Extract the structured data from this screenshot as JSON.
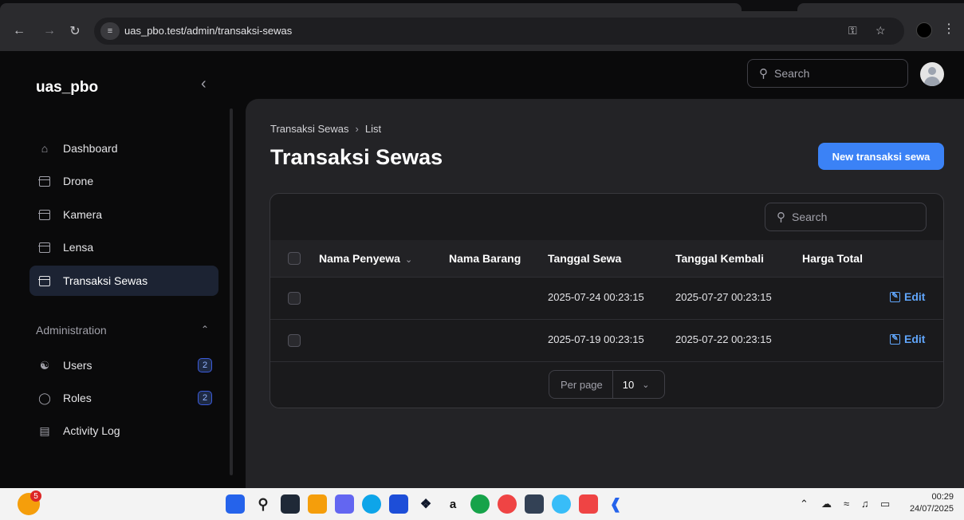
{
  "browser": {
    "url": "uas_pbo.test/admin/transaksi-sewas",
    "site_info_icon": "tune-icon"
  },
  "app": {
    "brand": "uas_pbo",
    "top_search_placeholder": "Search"
  },
  "sidebar": {
    "items": [
      {
        "label": "Dashboard",
        "icon": "home-icon"
      },
      {
        "label": "Drone",
        "icon": "box-icon"
      },
      {
        "label": "Kamera",
        "icon": "box-icon"
      },
      {
        "label": "Lensa",
        "icon": "box-icon"
      },
      {
        "label": "Transaksi Sewas",
        "icon": "box-icon",
        "active": true
      }
    ],
    "group_label": "Administration",
    "admin_items": [
      {
        "label": "Users",
        "icon": "users-icon",
        "badge": "2"
      },
      {
        "label": "Roles",
        "icon": "shield-check-icon",
        "badge": "2"
      },
      {
        "label": "Activity Log",
        "icon": "clipboard-icon"
      }
    ]
  },
  "main": {
    "breadcrumb": [
      "Transaksi Sewas",
      "List"
    ],
    "title": "Transaksi Sewas",
    "new_button": "New transaksi sewa",
    "table_search_placeholder": "Search",
    "columns": [
      "Nama Penyewa",
      "Nama Barang",
      "Tanggal Sewa",
      "Tanggal Kembali",
      "Harga Total"
    ],
    "rows": [
      {
        "nama_penyewa": "",
        "nama_barang": "",
        "tanggal_sewa": "2025-07-24 00:23:15",
        "tanggal_kembali": "2025-07-27 00:23:15",
        "harga_total": "",
        "action": "Edit"
      },
      {
        "nama_penyewa": "",
        "nama_barang": "",
        "tanggal_sewa": "2025-07-19 00:23:15",
        "tanggal_kembali": "2025-07-22 00:23:15",
        "harga_total": "",
        "action": "Edit"
      }
    ],
    "per_page_label": "Per page",
    "per_page_value": "10"
  },
  "taskbar": {
    "weather_badge": "5",
    "time": "00:29",
    "date": "24/07/2025"
  },
  "colors": {
    "accent": "#3b82f6",
    "link": "#60a5fa",
    "active_bg": "#1c2333"
  }
}
